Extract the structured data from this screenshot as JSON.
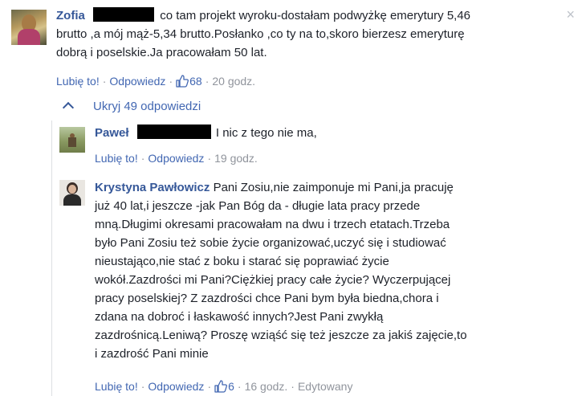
{
  "comments": [
    {
      "name": "Zofia",
      "text_lines": [
        "co tam projekt wyroku-dostałam podwyżkę emerytury 5,46",
        "brutto ,a mój mąż-5,34 brutto.Posłanko ,co ty na to,skoro bierzesz emeryturę",
        "dobrą i poselskie.Ja pracowałam 50 lat."
      ],
      "like_label": "Lubię to!",
      "reply_label": "Odpowiedz",
      "like_count": "68",
      "time": "20 godz."
    },
    {
      "name": "Paweł",
      "text_lines": [
        "I nic z tego nie ma,"
      ],
      "like_label": "Lubię to!",
      "reply_label": "Odpowiedz",
      "time": "19 godz."
    },
    {
      "name": "Krystyna Pawłowicz",
      "text_lines": [
        "Pani Zosiu,nie zaimponuje mi Pani,ja pracuję",
        "już 40 lat,i jeszcze -jak Pan Bóg da - długie lata pracy przede",
        "mną.Długimi okresami pracowałam na dwu i trzech etatach.Trzeba",
        "było Pani Zosiu też sobie życie organizować,uczyć się i studiować",
        "nieustająco,nie stać z boku i starać się poprawiać życie",
        "wokół.Zazdrości mi Pani?Ciężkiej pracy całe życie? Wyczerpującej",
        "pracy poselskiej? Z zazdrości chce Pani bym była biedna,chora i",
        "zdana na dobroć i łaskawość innych?Jest Pani zwykłą",
        "zazdrośnicą.Leniwą? Proszę wziąść się też jeszcze za jakiś zajęcie,to",
        "i zazdrość Pani minie"
      ],
      "like_label": "Lubię to!",
      "reply_label": "Odpowiedz",
      "like_count": "6",
      "time": "16 godz.",
      "edited": "Edytowany"
    }
  ],
  "hide_replies_label": "Ukryj 49 odpowiedzi",
  "close_symbol": "×",
  "dot": "·"
}
